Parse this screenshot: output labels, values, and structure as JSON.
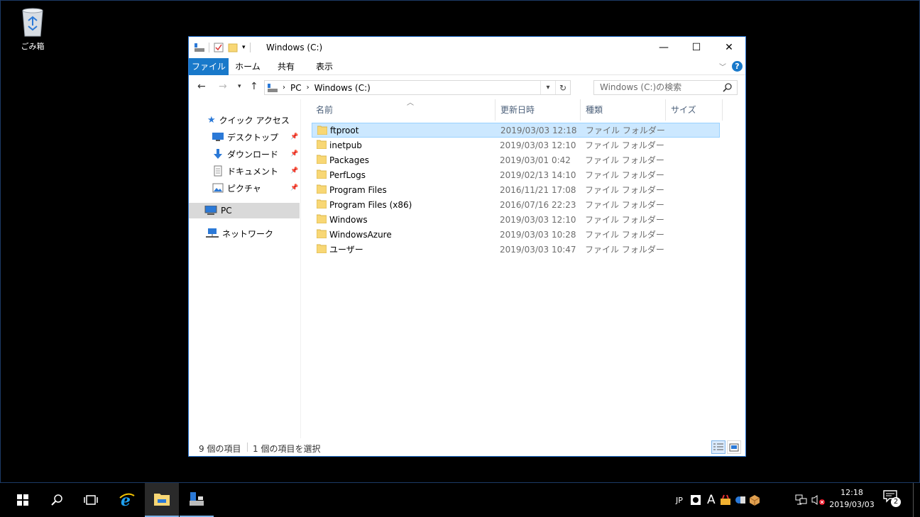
{
  "desktop": {
    "recycle_bin_label": "ごみ箱"
  },
  "window": {
    "title": "Windows (C:)",
    "controls": {
      "minimize": "—",
      "maximize": "☐",
      "close": "✕"
    }
  },
  "ribbon": {
    "tabs": [
      "ファイル",
      "ホーム",
      "共有",
      "表示"
    ],
    "help_label": "?"
  },
  "navbar": {
    "breadcrumb": [
      "PC",
      "Windows (C:)"
    ],
    "search_placeholder": "Windows (C:)の検索"
  },
  "navpane": {
    "quick_access": "クイック アクセス",
    "quick_items": [
      "デスクトップ",
      "ダウンロード",
      "ドキュメント",
      "ピクチャ"
    ],
    "pc": "PC",
    "network": "ネットワーク"
  },
  "columns": [
    "名前",
    "更新日時",
    "種類",
    "サイズ"
  ],
  "files": [
    {
      "name": "ftproot",
      "date": "2019/03/03 12:18",
      "type": "ファイル フォルダー"
    },
    {
      "name": "inetpub",
      "date": "2019/03/03 12:10",
      "type": "ファイル フォルダー"
    },
    {
      "name": "Packages",
      "date": "2019/03/01 0:42",
      "type": "ファイル フォルダー"
    },
    {
      "name": "PerfLogs",
      "date": "2019/02/13 14:10",
      "type": "ファイル フォルダー"
    },
    {
      "name": "Program Files",
      "date": "2016/11/21 17:08",
      "type": "ファイル フォルダー"
    },
    {
      "name": "Program Files (x86)",
      "date": "2016/07/16 22:23",
      "type": "ファイル フォルダー"
    },
    {
      "name": "Windows",
      "date": "2019/03/03 12:10",
      "type": "ファイル フォルダー"
    },
    {
      "name": "WindowsAzure",
      "date": "2019/03/03 10:28",
      "type": "ファイル フォルダー"
    },
    {
      "name": "ユーザー",
      "date": "2019/03/03 10:47",
      "type": "ファイル フォルダー"
    }
  ],
  "status": {
    "item_count": "9 個の項目",
    "selected": "1 個の項目を選択"
  },
  "taskbar": {
    "ime_label": "JP",
    "ime_mode": "A",
    "clock_time": "12:18",
    "clock_date": "2019/03/03",
    "notification_count": "2"
  },
  "colors": {
    "accent": "#1979ca",
    "selection": "#cce8ff",
    "folder": "#f8d775"
  }
}
